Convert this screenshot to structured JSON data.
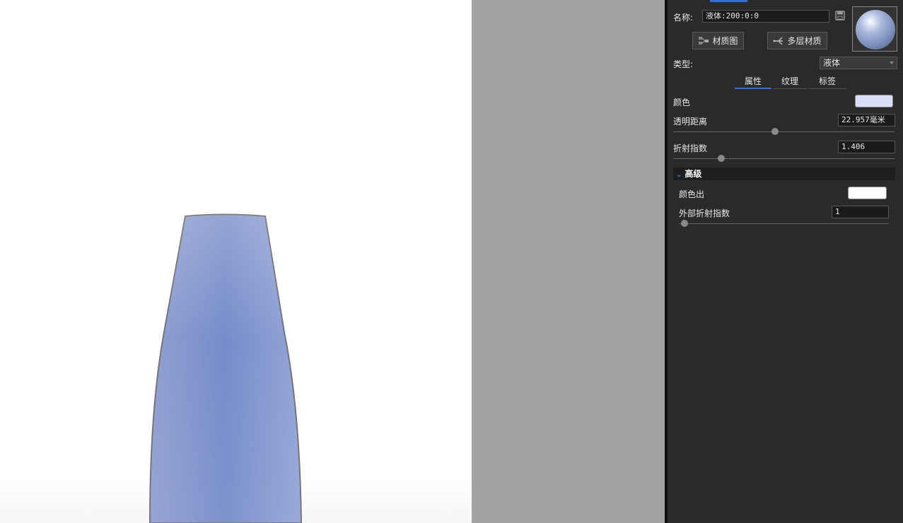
{
  "panel": {
    "name_label": "名称:",
    "name_value": "液体:200:0:0",
    "buttons": {
      "material_graph": "材质图",
      "multi_layer": "多层材质"
    },
    "type_label": "类型:",
    "type_value": "液体",
    "tabs": [
      {
        "label": "属性",
        "active": true
      },
      {
        "label": "纹理",
        "active": false
      },
      {
        "label": "标签",
        "active": false
      }
    ],
    "color_label": "颜色",
    "color_value": "#d8def6",
    "transparency_label": "透明距离",
    "transparency_value": "22.957毫米",
    "transparency_slider": 0.47,
    "ior_label": "折射指数",
    "ior_value": "1.406",
    "ior_slider": 0.22,
    "advanced": {
      "header": "高级",
      "color_out_label": "颜色出",
      "color_out_value": "#ffffff",
      "outer_ior_label": "外部折射指数",
      "outer_ior_value": "1",
      "outer_ior_slider": 0.0
    }
  },
  "icons": {
    "save": "save-icon",
    "material_graph": "material-graph-icon",
    "multi_layer": "multi-layer-icon",
    "dropdown": "chevron-down-icon",
    "advanced": "chevron-down-icon"
  },
  "colors": {
    "accent": "#2f6fd6",
    "panel_bg": "#2a2a2a",
    "viewport_bg": "#ffffff",
    "gap_gray": "#a3a3a3",
    "liquid": "#7f95cf"
  }
}
